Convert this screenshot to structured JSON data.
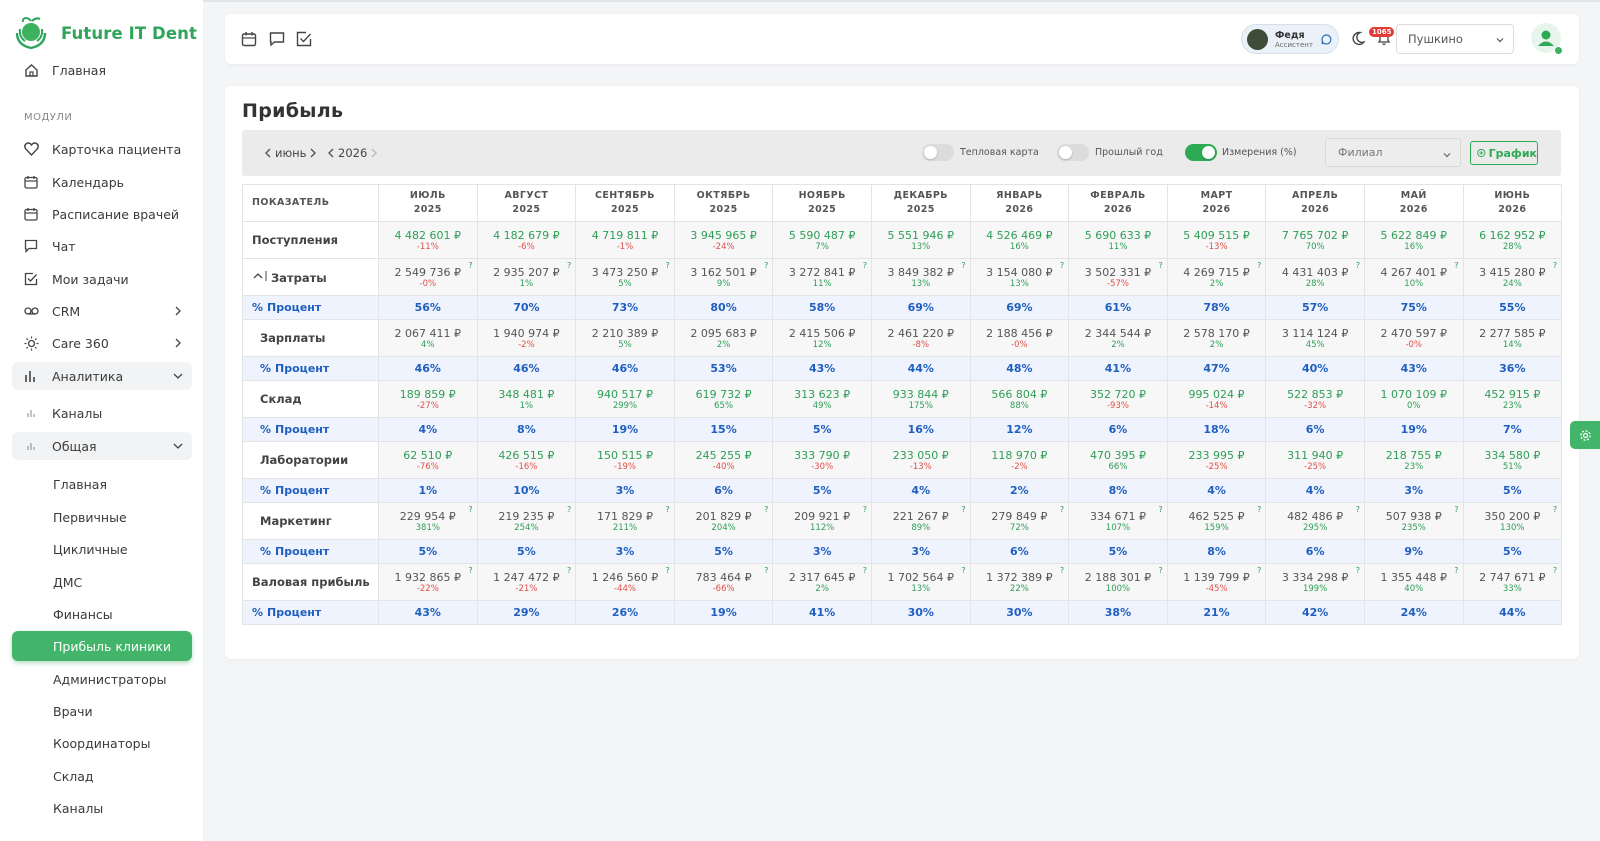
{
  "app": {
    "name": "Future IT Dent"
  },
  "sidebar": {
    "home": "Главная",
    "section": "МОДУЛИ",
    "items": [
      {
        "label": "Карточка пациента",
        "icon": "heart-icon"
      },
      {
        "label": "Календарь",
        "icon": "calendar-icon"
      },
      {
        "label": "Расписание врачей",
        "icon": "calendar-icon"
      },
      {
        "label": "Чат",
        "icon": "chat-icon"
      },
      {
        "label": "Мои задачи",
        "icon": "tasks-icon"
      },
      {
        "label": "CRM",
        "icon": "crm-icon"
      },
      {
        "label": "Care 360",
        "icon": "sun-icon"
      },
      {
        "label": "Аналитика",
        "icon": "bar-chart-icon"
      }
    ],
    "analytics_sub": [
      {
        "label": "Каналы"
      },
      {
        "label": "Общая"
      }
    ],
    "general_sub": [
      "Главная",
      "Первичные",
      "Цикличные",
      "ДМС",
      "Финансы",
      "Прибыль клиники",
      "Администраторы",
      "Врачи",
      "Координаторы",
      "Склад",
      "Каналы"
    ],
    "active": "Прибыль клиники"
  },
  "topbar": {
    "user_name": "Федя",
    "user_role": "Ассистент",
    "notifications": "1065",
    "branch": "Пушкино"
  },
  "page": {
    "title": "Прибыль",
    "month": "июнь",
    "year": "2026",
    "toggles": {
      "heatmap": "Тепловая карта",
      "last_year": "Прошлый год",
      "measure": "Измерения (%)"
    },
    "branch_placeholder": "Филиал",
    "graph_button": "График"
  },
  "table": {
    "header_first": "ПОКАЗАТЕЛЬ",
    "months": [
      [
        "ИЮЛЬ",
        "2025"
      ],
      [
        "АВГУСТ",
        "2025"
      ],
      [
        "СЕНТЯБРЬ",
        "2025"
      ],
      [
        "ОКТЯБРЬ",
        "2025"
      ],
      [
        "НОЯБРЬ",
        "2025"
      ],
      [
        "ДЕКАБРЬ",
        "2025"
      ],
      [
        "ЯНВАРЬ",
        "2026"
      ],
      [
        "ФЕВРАЛЬ",
        "2026"
      ],
      [
        "МАРТ",
        "2026"
      ],
      [
        "АПРЕЛЬ",
        "2026"
      ],
      [
        "МАЙ",
        "2026"
      ],
      [
        "ИЮНЬ",
        "2026"
      ]
    ],
    "rows": [
      {
        "label": "Поступления",
        "kind": "value",
        "color": "green",
        "child": false,
        "question": false,
        "values": [
          "4 482 601 ₽",
          "4 182 679 ₽",
          "4 719 811 ₽",
          "3 945 965 ₽",
          "5 590 487 ₽",
          "5 551 946 ₽",
          "4 526 469 ₽",
          "5 690 633 ₽",
          "5 409 515 ₽",
          "7 765 702 ₽",
          "5 622 849 ₽",
          "6 162 952 ₽"
        ],
        "changes": [
          "-11%",
          "-6%",
          "-1%",
          "-24%",
          "7%",
          "13%",
          "16%",
          "11%",
          "-13%",
          "70%",
          "16%",
          "28%"
        ]
      },
      {
        "label": "Затраты",
        "kind": "value",
        "color": "gray",
        "child": false,
        "question": true,
        "collapsible": true,
        "values": [
          "2 549 736 ₽",
          "2 935 207 ₽",
          "3 473 250 ₽",
          "3 162 501 ₽",
          "3 272 841 ₽",
          "3 849 382 ₽",
          "3 154 080 ₽",
          "3 502 331 ₽",
          "4 269 715 ₽",
          "4 431 403 ₽",
          "4 267 401 ₽",
          "3 415 280 ₽"
        ],
        "changes": [
          "-0%",
          "1%",
          "5%",
          "9%",
          "11%",
          "13%",
          "13%",
          "-57%",
          "2%",
          "28%",
          "10%",
          "24%"
        ]
      },
      {
        "label": "Процент",
        "kind": "percent",
        "child": false,
        "values": [
          "56%",
          "70%",
          "73%",
          "80%",
          "58%",
          "69%",
          "69%",
          "61%",
          "78%",
          "57%",
          "75%",
          "55%"
        ]
      },
      {
        "label": "Зарплаты",
        "kind": "value",
        "color": "gray",
        "child": true,
        "question": false,
        "values": [
          "2 067 411 ₽",
          "1 940 974 ₽",
          "2 210 389 ₽",
          "2 095 683 ₽",
          "2 415 506 ₽",
          "2 461 220 ₽",
          "2 188 456 ₽",
          "2 344 544 ₽",
          "2 578 170 ₽",
          "3 114 124 ₽",
          "2 470 597 ₽",
          "2 277 585 ₽"
        ],
        "changes": [
          "4%",
          "-2%",
          "5%",
          "2%",
          "12%",
          "-8%",
          "-0%",
          "2%",
          "2%",
          "45%",
          "-0%",
          "14%"
        ]
      },
      {
        "label": "Процент",
        "kind": "percent",
        "child": true,
        "values": [
          "46%",
          "46%",
          "46%",
          "53%",
          "43%",
          "44%",
          "48%",
          "41%",
          "47%",
          "40%",
          "43%",
          "36%"
        ]
      },
      {
        "label": "Склад",
        "kind": "value",
        "color": "green",
        "child": true,
        "question": false,
        "values": [
          "189 859 ₽",
          "348 481 ₽",
          "940 517 ₽",
          "619 732 ₽",
          "313 623 ₽",
          "933 844 ₽",
          "566 804 ₽",
          "352 720 ₽",
          "995 024 ₽",
          "522 853 ₽",
          "1 070 109 ₽",
          "452 915 ₽"
        ],
        "changes": [
          "-27%",
          "1%",
          "299%",
          "65%",
          "49%",
          "175%",
          "88%",
          "-93%",
          "-14%",
          "-32%",
          "0%",
          "23%"
        ]
      },
      {
        "label": "Процент",
        "kind": "percent",
        "child": true,
        "values": [
          "4%",
          "8%",
          "19%",
          "15%",
          "5%",
          "16%",
          "12%",
          "6%",
          "18%",
          "6%",
          "19%",
          "7%"
        ]
      },
      {
        "label": "Лаборатории",
        "kind": "value",
        "color": "green",
        "child": true,
        "question": false,
        "values": [
          "62 510 ₽",
          "426 515 ₽",
          "150 515 ₽",
          "245 255 ₽",
          "333 790 ₽",
          "233 050 ₽",
          "118 970 ₽",
          "470 395 ₽",
          "233 995 ₽",
          "311 940 ₽",
          "218 755 ₽",
          "334 580 ₽"
        ],
        "changes": [
          "-76%",
          "-16%",
          "-19%",
          "-40%",
          "-30%",
          "-13%",
          "-2%",
          "66%",
          "-25%",
          "-25%",
          "23%",
          "51%"
        ]
      },
      {
        "label": "Процент",
        "kind": "percent",
        "child": true,
        "values": [
          "1%",
          "10%",
          "3%",
          "6%",
          "5%",
          "4%",
          "2%",
          "8%",
          "4%",
          "4%",
          "3%",
          "5%"
        ]
      },
      {
        "label": "Маркетинг",
        "kind": "value",
        "color": "gray",
        "child": true,
        "question": true,
        "values": [
          "229 954 ₽",
          "219 235 ₽",
          "171 829 ₽",
          "201 829 ₽",
          "209 921 ₽",
          "221 267 ₽",
          "279 849 ₽",
          "334 671 ₽",
          "462 525 ₽",
          "482 486 ₽",
          "507 938 ₽",
          "350 200 ₽"
        ],
        "changes": [
          "381%",
          "254%",
          "211%",
          "204%",
          "112%",
          "89%",
          "72%",
          "107%",
          "159%",
          "295%",
          "235%",
          "130%"
        ]
      },
      {
        "label": "Процент",
        "kind": "percent",
        "child": true,
        "values": [
          "5%",
          "5%",
          "3%",
          "5%",
          "3%",
          "3%",
          "6%",
          "5%",
          "8%",
          "6%",
          "9%",
          "5%"
        ]
      },
      {
        "label": "Валовая прибыль",
        "kind": "value",
        "color": "gray",
        "child": false,
        "question": true,
        "values": [
          "1 932 865 ₽",
          "1 247 472 ₽",
          "1 246 560 ₽",
          "783 464 ₽",
          "2 317 645 ₽",
          "1 702 564 ₽",
          "1 372 389 ₽",
          "2 188 301 ₽",
          "1 139 799 ₽",
          "3 334 298 ₽",
          "1 355 448 ₽",
          "2 747 671 ₽"
        ],
        "changes": [
          "-22%",
          "-21%",
          "-44%",
          "-66%",
          "2%",
          "13%",
          "22%",
          "100%",
          "-45%",
          "199%",
          "40%",
          "33%"
        ]
      },
      {
        "label": "Процент",
        "kind": "percent",
        "child": false,
        "values": [
          "43%",
          "29%",
          "26%",
          "19%",
          "41%",
          "30%",
          "30%",
          "38%",
          "21%",
          "42%",
          "24%",
          "44%"
        ]
      }
    ]
  },
  "colors": {
    "brand": "#2fa45a",
    "positive": "#2e9e57",
    "negative": "#e0504a",
    "percent_row": "#1f5fbf"
  }
}
